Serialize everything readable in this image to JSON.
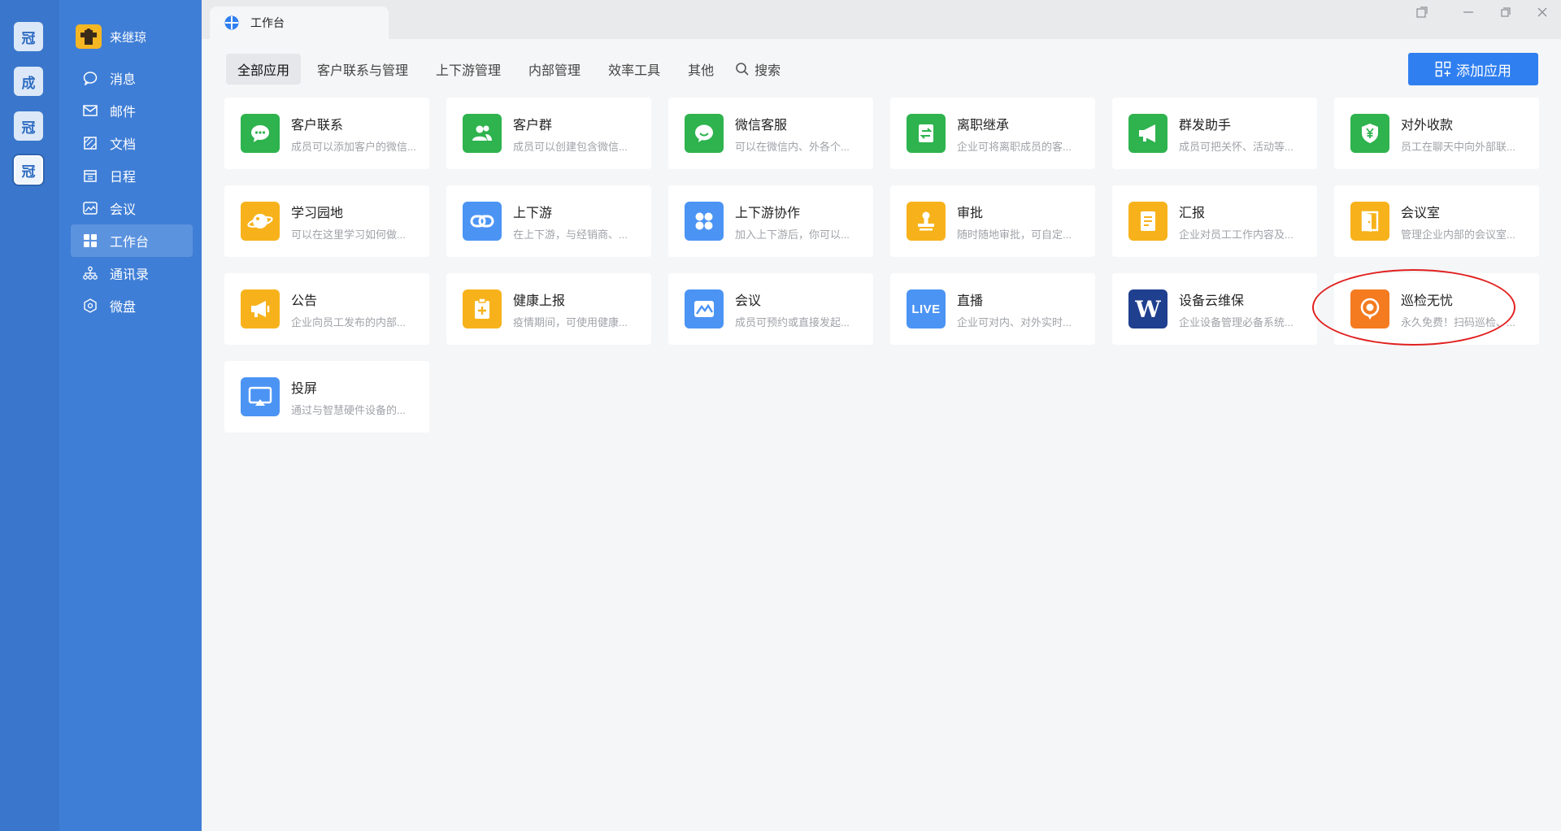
{
  "accounts": [
    "冠",
    "成",
    "冠",
    "冠"
  ],
  "profile": {
    "name": "来继琼"
  },
  "nav": [
    {
      "label": "消息",
      "icon": "chat-bubble-icon"
    },
    {
      "label": "邮件",
      "icon": "mail-icon"
    },
    {
      "label": "文档",
      "icon": "document-icon"
    },
    {
      "label": "日程",
      "icon": "calendar-icon"
    },
    {
      "label": "会议",
      "icon": "meeting-icon"
    },
    {
      "label": "工作台",
      "icon": "workbench-grid-icon",
      "active": true
    },
    {
      "label": "通讯录",
      "icon": "contacts-tree-icon"
    },
    {
      "label": "微盘",
      "icon": "cloud-disk-icon"
    }
  ],
  "window": {
    "tab_title": "工作台"
  },
  "filters": [
    "全部应用",
    "客户联系与管理",
    "上下游管理",
    "内部管理",
    "效率工具",
    "其他"
  ],
  "search_label": "搜索",
  "add_app_label": "添加应用",
  "apps": [
    {
      "name": "客户联系",
      "desc": "成员可以添加客户的微信...",
      "color": "#2eb34e",
      "icon": "chat-icon"
    },
    {
      "name": "客户群",
      "desc": "成员可以创建包含微信...",
      "color": "#2eb34e",
      "icon": "group-icon"
    },
    {
      "name": "微信客服",
      "desc": "可以在微信内、外各个...",
      "color": "#2eb34e",
      "icon": "service-chat-icon"
    },
    {
      "name": "离职继承",
      "desc": "企业可将离职成员的客...",
      "color": "#2eb34e",
      "icon": "transfer-icon"
    },
    {
      "name": "群发助手",
      "desc": "成员可把关怀、活动等...",
      "color": "#2eb34e",
      "icon": "megaphone-icon"
    },
    {
      "name": "对外收款",
      "desc": "员工在聊天中向外部联...",
      "color": "#2eb34e",
      "icon": "yuan-shield-icon"
    },
    {
      "name": "学习园地",
      "desc": "可以在这里学习如何做...",
      "color": "#f7b21b",
      "icon": "planet-icon"
    },
    {
      "name": "上下游",
      "desc": "在上下游，与经销商、...",
      "color": "#4b94f4",
      "icon": "link-icon"
    },
    {
      "name": "上下游协作",
      "desc": "加入上下游后，你可以...",
      "color": "#4b94f4",
      "icon": "four-dots-icon"
    },
    {
      "name": "审批",
      "desc": "随时随地审批，可自定...",
      "color": "#f7b21b",
      "icon": "stamp-icon"
    },
    {
      "name": "汇报",
      "desc": "企业对员工工作内容及...",
      "color": "#f7b21b",
      "icon": "report-doc-icon"
    },
    {
      "name": "会议室",
      "desc": "管理企业内部的会议室...",
      "color": "#f7b21b",
      "icon": "door-icon"
    },
    {
      "name": "公告",
      "desc": "企业向员工发布的内部...",
      "color": "#f7b21b",
      "icon": "announcement-icon"
    },
    {
      "name": "健康上报",
      "desc": "疫情期间，可使用健康...",
      "color": "#f7b21b",
      "icon": "clipboard-plus-icon"
    },
    {
      "name": "会议",
      "desc": "成员可预约或直接发起...",
      "color": "#4b94f4",
      "icon": "meeting-mountain-icon"
    },
    {
      "name": "直播",
      "desc": "企业可对内、对外实时...",
      "color": "#4b94f4",
      "icon": "live-icon",
      "badge": "LIVE"
    },
    {
      "name": "设备云维保",
      "desc": "企业设备管理必备系统...",
      "color": "#1f3f8f",
      "icon": "w-logo-icon",
      "badge": "W"
    },
    {
      "name": "巡检无忧",
      "desc": "永久免费！扫码巡检、...",
      "color": "#f47b20",
      "icon": "location-pin-icon"
    },
    {
      "name": "投屏",
      "desc": "通过与智慧硬件设备的...",
      "color": "#4b94f4",
      "icon": "screen-cast-icon"
    }
  ],
  "colors": {
    "rail": "#3a77cc",
    "sidebar": "#3f7ed6",
    "accent": "#2f7ff0",
    "highlight_ring": "#e0201f"
  }
}
